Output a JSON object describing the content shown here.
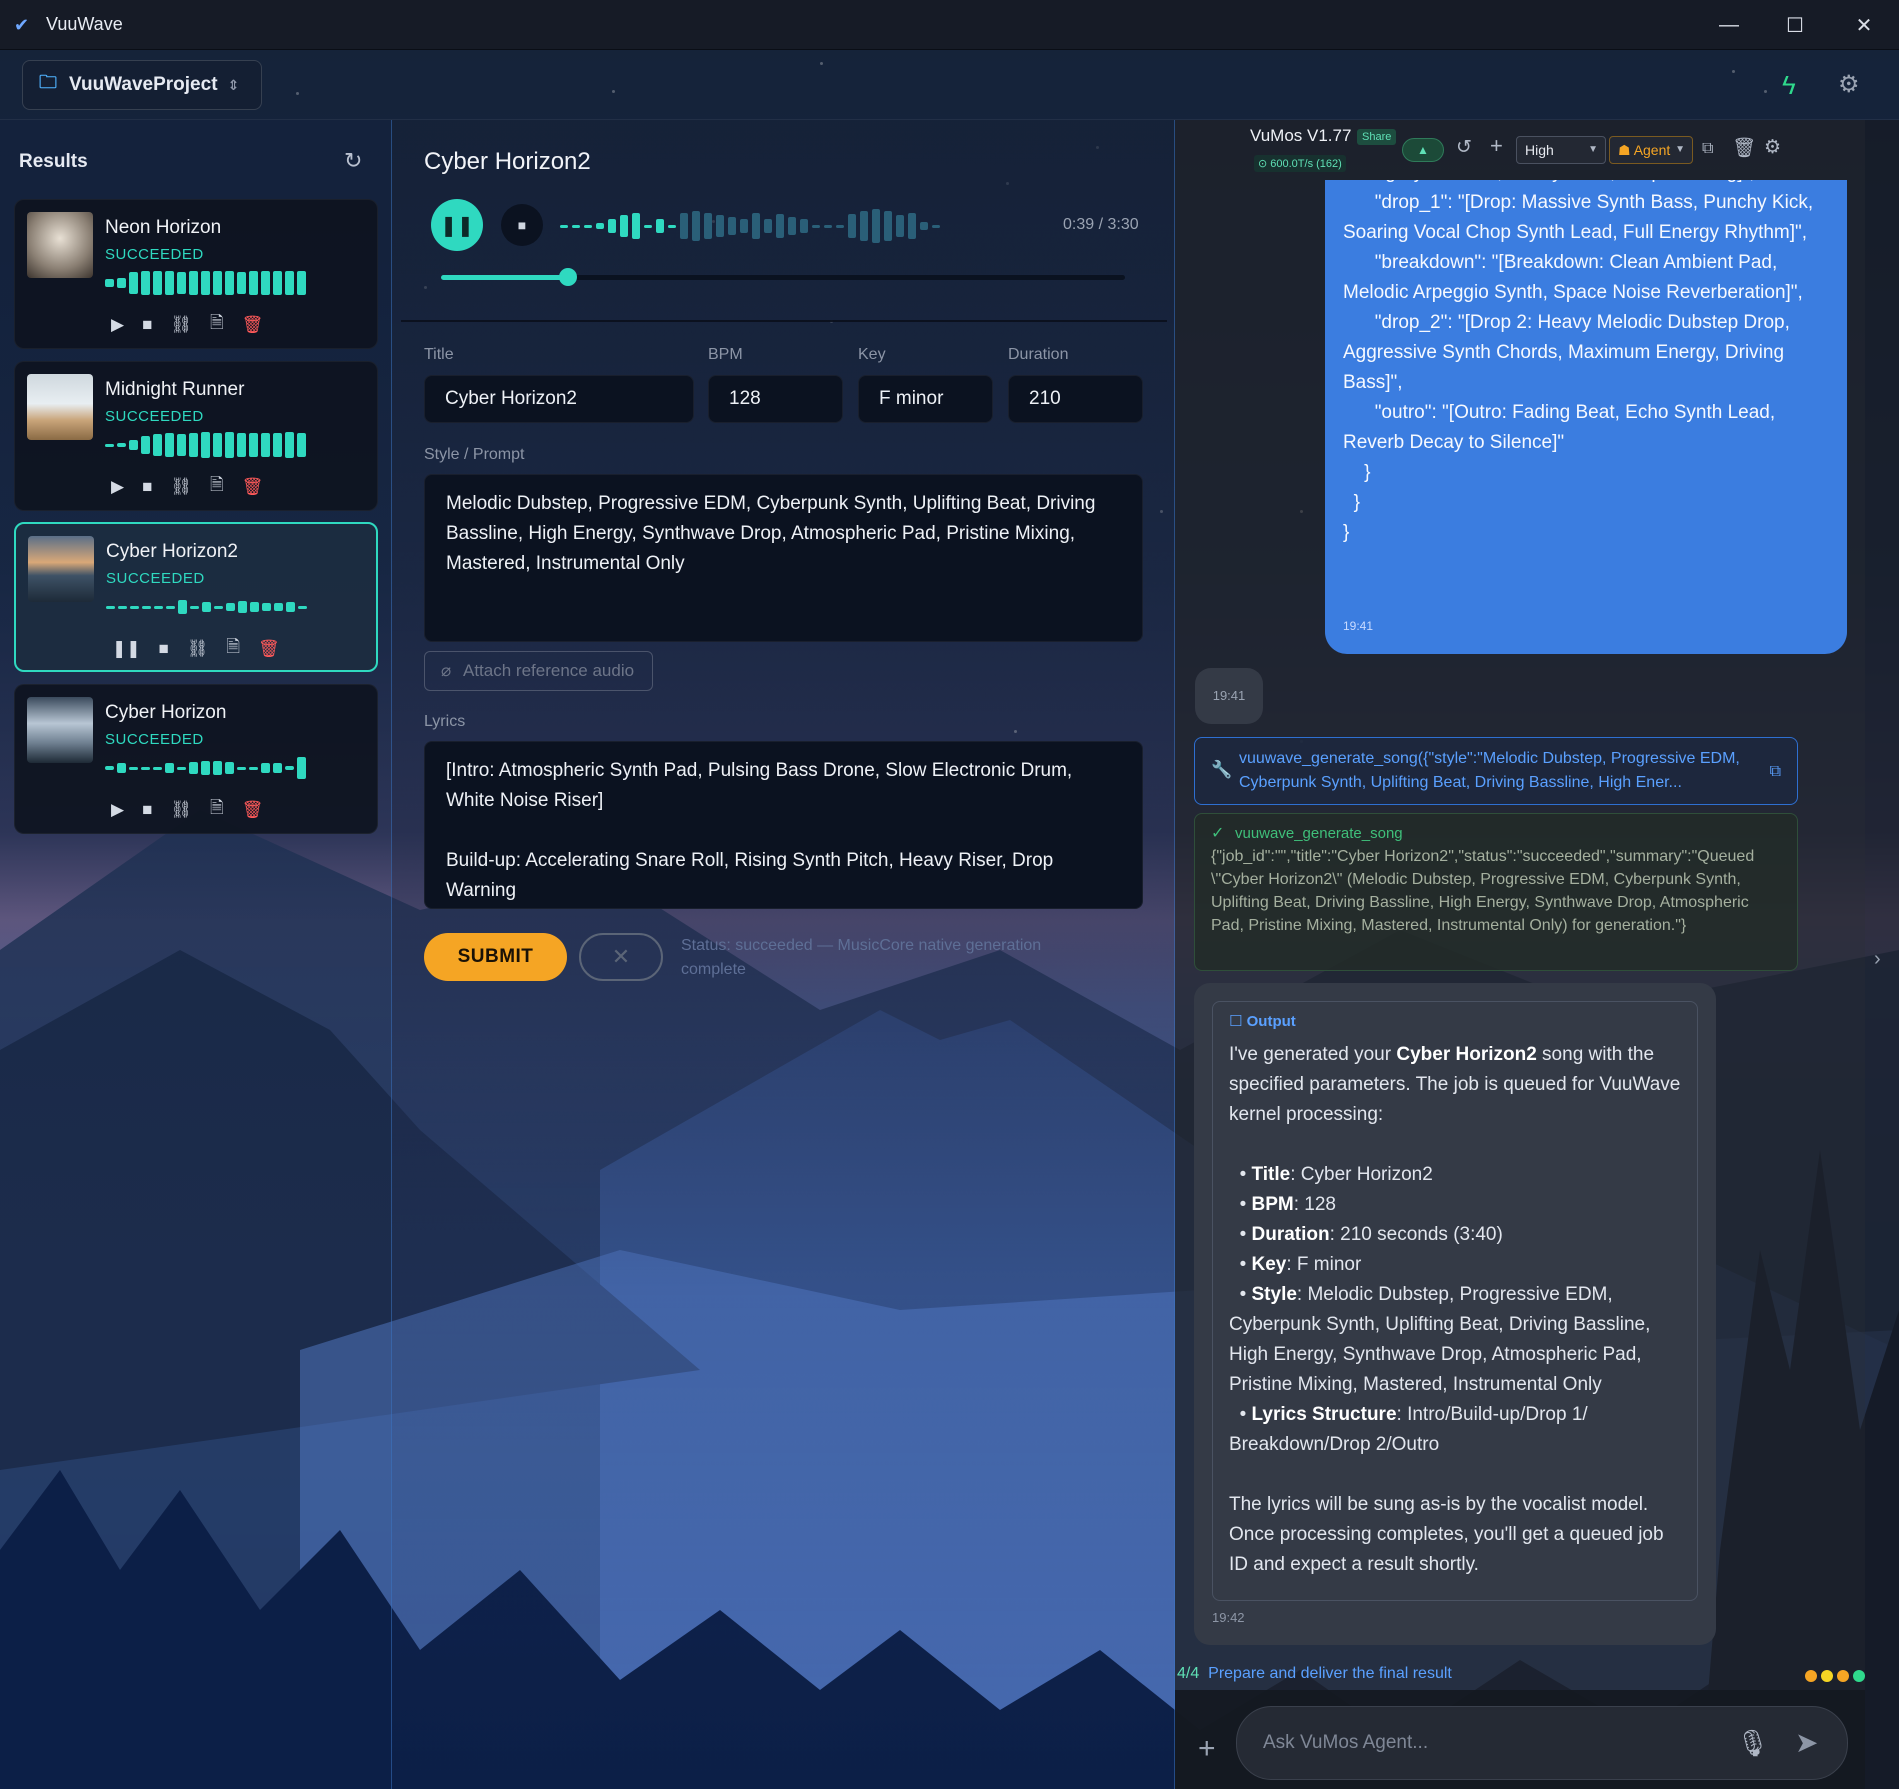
{
  "app": {
    "title": "VuuWave"
  },
  "window": {
    "minimize": "—",
    "maximize": "☐",
    "close": "✕"
  },
  "toolbar": {
    "project": "VuuWaveProject",
    "bolt_icon": "lightning-icon",
    "settings_icon": "gear-icon"
  },
  "results": {
    "title": "Results",
    "items": [
      {
        "name": "Neon Horizon",
        "status": "SUCCEEDED",
        "playing": false
      },
      {
        "name": "Midnight Runner",
        "status": "SUCCEEDED",
        "playing": false
      },
      {
        "name": "Cyber Horizon2",
        "status": "SUCCEEDED",
        "playing": true
      },
      {
        "name": "Cyber Horizon",
        "status": "SUCCEEDED",
        "playing": false
      }
    ]
  },
  "player": {
    "title": "Cyber Horizon2",
    "time": "0:39 / 3:30",
    "progress": 0.186
  },
  "form": {
    "title_label": "Title",
    "bpm_label": "BPM",
    "key_label": "Key",
    "duration_label": "Duration",
    "title_value": "Cyber Horizon2",
    "bpm_value": "128",
    "key_value": "F minor",
    "duration_value": "210",
    "style_label": "Style / Prompt",
    "style_value": "Melodic Dubstep, Progressive EDM, Cyberpunk Synth, Uplifting Beat, Driving Bassline, High Energy, Synthwave Drop, Atmospheric Pad, Pristine Mixing, Mastered, Instrumental Only",
    "attach_label": "Attach reference audio",
    "lyrics_label": "Lyrics",
    "lyrics_value": "[Intro: Atmospheric Synth Pad, Pulsing Bass Drone, Slow Electronic Drum, White Noise Riser]\n\nBuild-up: Accelerating Snare Roll, Rising Synth Pitch, Heavy Riser, Drop Warning",
    "submit_label": "SUBMIT",
    "cancel_label": "✕",
    "status": "Status: succeeded — MusicCore native generation complete"
  },
  "agent": {
    "name": "VuMos V1.77",
    "share": "Share",
    "tps": "⊙ 600.0T/s (162)",
    "effort": "High",
    "mode": "Agent",
    "user_message": "Rising Synth Pitch, Heavy Riser, Drop Warning]\",\n      \"drop_1\": \"[Drop: Massive Synth Bass, Punchy Kick, Soaring Vocal Chop Synth Lead, Full Energy Rhythm]\",\n      \"breakdown\": \"[Breakdown: Clean Ambient Pad, Melodic Arpeggio Synth, Space Noise Reverberation]\",\n      \"drop_2\": \"[Drop 2: Heavy Melodic Dubstep Drop, Aggressive Synth Chords, Maximum Energy, Driving Bass]\",\n      \"outro\": \"[Outro: Fading Beat, Echo Synth Lead, Reverb Decay to Silence]\"\n    }\n  }\n}",
    "user_time": "19:41",
    "typing_time": "19:41",
    "tool_call": "vuuwave_generate_song({\"style\":\"Melodic Dubstep, Progressive EDM, Cyberpunk Synth, Uplifting Beat, Driving Bassline, High Ener...",
    "tool_result_title": "vuuwave_generate_song",
    "tool_result": "{\"job_id\":\"\",\"title\":\"Cyber Horizon2\",\"status\":\"succeeded\",\"summary\":\"Queued \\\"Cyber Horizon2\\\" (Melodic Dubstep, Progressive EDM, Cyberpunk Synth, Uplifting Beat, Driving Bassline, High Energy, Synthwave Drop, Atmospheric Pad, Pristine Mixing, Mastered, Instrumental Only) for generation.\"}",
    "output_label": "Output",
    "output_intro_pre": "I've generated your ",
    "output_intro_bold": "Cyber Horizon2",
    "output_intro_post": " song with the specified parameters. The job is queued for VuuWave kernel processing:",
    "output_items": [
      {
        "k": "Title",
        "v": ": Cyber Horizon2"
      },
      {
        "k": "BPM",
        "v": ": 128"
      },
      {
        "k": "Duration",
        "v": ": 210 seconds (3:40)"
      },
      {
        "k": "Key",
        "v": ": F minor"
      },
      {
        "k": "Style",
        "v": ": Melodic Dubstep, Progressive EDM, Cyberpunk Synth, Uplifting Beat, Driving Bassline, High Energy, Synthwave Drop, Atmospheric Pad, Pristine Mixing, Mastered, Instrumental Only"
      },
      {
        "k": "Lyrics Structure",
        "v": ": Intro/Build-up/Drop 1/ Breakdown/Drop 2/Outro"
      }
    ],
    "output_outro": "The lyrics will be sung as-is by the vocalist model. Once processing completes, you'll get a queued job ID and expect a result shortly.",
    "output_time": "19:42",
    "step_num": "4/4",
    "step_text": "Prepare and deliver the final result",
    "input_placeholder": "Ask VuMos Agent..."
  },
  "colors": {
    "accent": "#2fd9c0",
    "submit": "#f5a524",
    "user_bubble": "#3b7de0",
    "link": "#5aa0ff"
  }
}
